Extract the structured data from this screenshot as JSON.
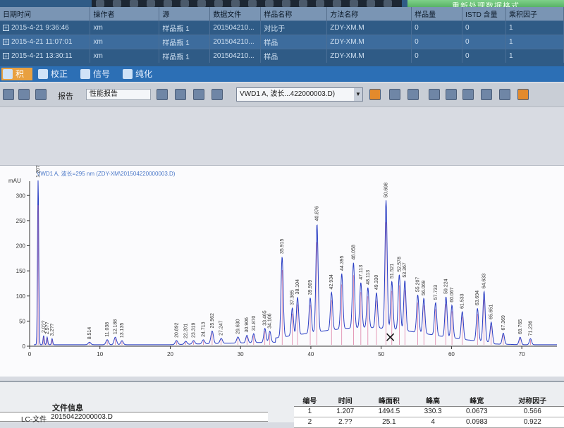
{
  "reprocess_button": "重新处理数据格式",
  "sample_table": {
    "columns": [
      "日期时间",
      "操作者",
      "源",
      "数据文件",
      "样品名称",
      "方法名称",
      "样品量",
      "ISTD 含量",
      "乘积因子"
    ],
    "rows": [
      [
        "2015-4-21 9:36:46",
        "xm",
        "样品瓶 1",
        "201504210...",
        "对比于",
        "ZDY-XM.M",
        "0",
        "0",
        "1"
      ],
      [
        "2015-4-21 11:07:01",
        "xm",
        "样品瓶 1",
        "201504210...",
        "样品",
        "ZDY-XM.M",
        "0",
        "0",
        "1"
      ],
      [
        "2015-4-21 13:30:11",
        "xm",
        "样品瓶 1",
        "201504210...",
        "样品",
        "ZDY-XM.M",
        "0",
        "0",
        "1"
      ]
    ]
  },
  "tabs": [
    {
      "label": "积分",
      "active": true
    },
    {
      "label": "校正",
      "active": false
    },
    {
      "label": "信号",
      "active": false
    },
    {
      "label": "纯化",
      "active": false
    }
  ],
  "toolbar": {
    "report_label": "报告",
    "report_select": "性能报告",
    "signal_select": "VWD1 A, 波长...422000003.D)"
  },
  "chart_title": "VWD1 A, 波长=295 nm (ZDY-XM\\201504220000003.D)",
  "chart_data": {
    "type": "line",
    "ylabel": "mAU",
    "xlim": [
      0,
      75
    ],
    "ylim": [
      0,
      320
    ],
    "xticks": [
      "0",
      "10",
      "20",
      "30",
      "40",
      "50",
      "60",
      "70"
    ],
    "yticks": [
      "0",
      "50",
      "100",
      "150",
      "200",
      "250",
      "300"
    ],
    "peaks": [
      {
        "rt": 1.207,
        "h": 330,
        "label": "1.207"
      },
      {
        "rt": 2.0,
        "h": 18,
        "label": "2.0??"
      },
      {
        "rt": 2.5,
        "h": 15,
        "label": "2.5??"
      },
      {
        "rt": 3.2,
        "h": 12,
        "label": "3.2??"
      },
      {
        "rt": 8.514,
        "h": 5,
        "label": "8.514"
      },
      {
        "rt": 11.038,
        "h": 10,
        "label": "11.038"
      },
      {
        "rt": 12.188,
        "h": 15,
        "label": "12.188"
      },
      {
        "rt": 13.135,
        "h": 8,
        "label": "13.135"
      },
      {
        "rt": 20.892,
        "h": 8,
        "label": "20.892"
      },
      {
        "rt": 22.201,
        "h": 6,
        "label": "22.201"
      },
      {
        "rt": 23.319,
        "h": 7,
        "label": "23.319"
      },
      {
        "rt": 24.713,
        "h": 8,
        "label": "24.713"
      },
      {
        "rt": 25.962,
        "h": 25,
        "label": "25.962"
      },
      {
        "rt": 27.247,
        "h": 10,
        "label": "27.247"
      },
      {
        "rt": 29.63,
        "h": 12,
        "label": "29.630"
      },
      {
        "rt": 30.906,
        "h": 15,
        "label": "30.906"
      },
      {
        "rt": 31.87,
        "h": 18,
        "label": "31.870"
      },
      {
        "rt": 33.465,
        "h": 28,
        "label": "33.465"
      },
      {
        "rt": 34.166,
        "h": 22,
        "label": "34.166"
      },
      {
        "rt": 35.915,
        "h": 160,
        "label": "35.915"
      },
      {
        "rt": 37.365,
        "h": 55,
        "label": "37.365"
      },
      {
        "rt": 38.104,
        "h": 75,
        "label": "38.104"
      },
      {
        "rt": 39.909,
        "h": 70,
        "label": "39.909"
      },
      {
        "rt": 40.876,
        "h": 215,
        "label": "40.876"
      },
      {
        "rt": 42.934,
        "h": 75,
        "label": "42.934"
      },
      {
        "rt": 44.395,
        "h": 110,
        "label": "44.395"
      },
      {
        "rt": 46.058,
        "h": 130,
        "label": "46.058"
      },
      {
        "rt": 47.113,
        "h": 90,
        "label": "47.113"
      },
      {
        "rt": 48.113,
        "h": 80,
        "label": "48.113"
      },
      {
        "rt": 49.33,
        "h": 70,
        "label": "49.330"
      },
      {
        "rt": 50.698,
        "h": 255,
        "label": "50.698"
      },
      {
        "rt": 51.521,
        "h": 95,
        "label": "51.521"
      },
      {
        "rt": 52.578,
        "h": 110,
        "label": "52.578"
      },
      {
        "rt": 53.367,
        "h": 100,
        "label": "53.367"
      },
      {
        "rt": 55.207,
        "h": 75,
        "label": "55.207"
      },
      {
        "rt": 56.069,
        "h": 70,
        "label": "56.069"
      },
      {
        "rt": 57.733,
        "h": 65,
        "label": "57.733"
      },
      {
        "rt": 59.224,
        "h": 80,
        "label": "59.224"
      },
      {
        "rt": 60.067,
        "h": 65,
        "label": "60.067"
      },
      {
        "rt": 61.533,
        "h": 55,
        "label": "61.533"
      },
      {
        "rt": 63.694,
        "h": 65,
        "label": "63.694"
      },
      {
        "rt": 64.633,
        "h": 100,
        "label": "64.633"
      },
      {
        "rt": 65.651,
        "h": 40,
        "label": "65.651"
      },
      {
        "rt": 67.369,
        "h": 22,
        "label": "67.369"
      },
      {
        "rt": 69.765,
        "h": 15,
        "label": "69.765"
      },
      {
        "rt": 71.236,
        "h": 12,
        "label": "71.236"
      }
    ]
  },
  "file_info": {
    "title": "文件信息",
    "label": "LC-文件",
    "value": "20150422000003.D"
  },
  "peak_table": {
    "columns": [
      "编号",
      "时间",
      "峰面积",
      "峰高",
      "峰宽",
      "对称因子"
    ],
    "rows": [
      [
        "1",
        "1.207",
        "1494.5",
        "330.3",
        "0.0673",
        "0.566"
      ],
      [
        "2",
        "2.??",
        "25.1",
        "4",
        "0.0983",
        "0.922"
      ]
    ]
  }
}
